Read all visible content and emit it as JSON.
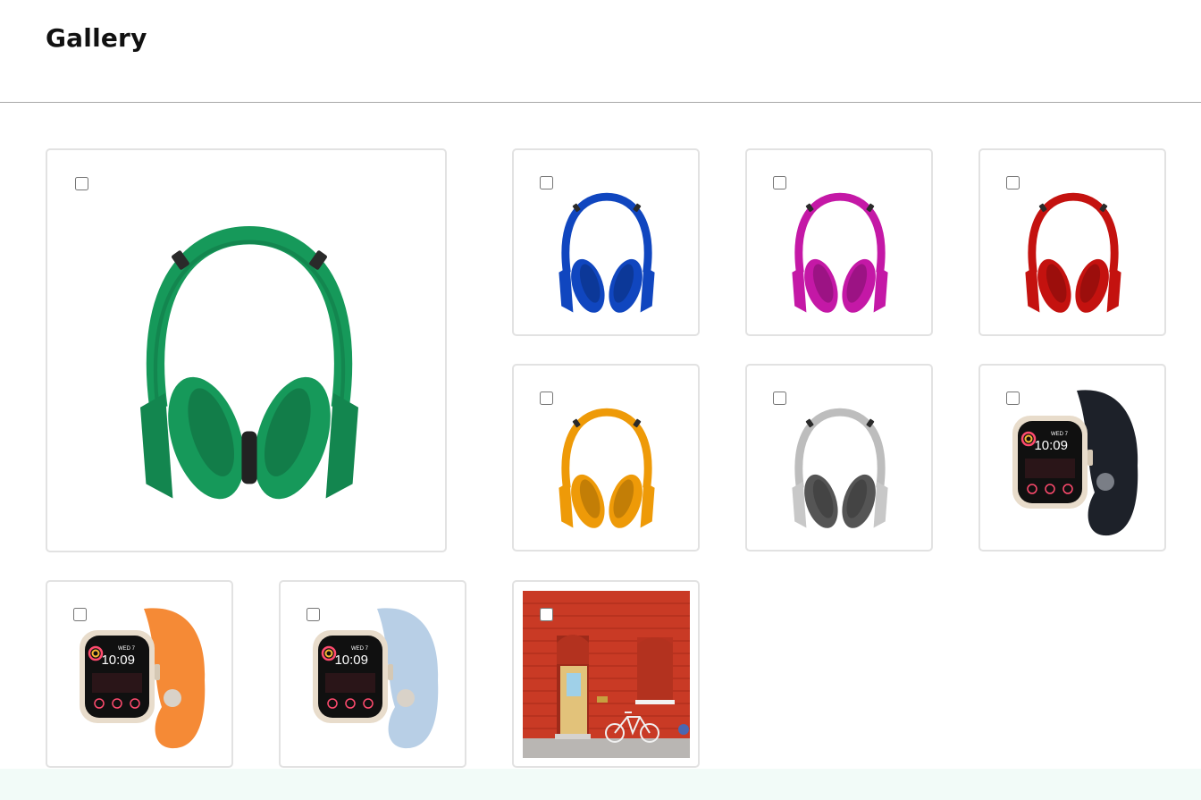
{
  "header": {
    "title": "Gallery"
  },
  "gallery": {
    "items": [
      {
        "image": "headphones",
        "color": "#16995a",
        "selected": false
      },
      {
        "image": "headphones",
        "color": "#1046bf",
        "selected": false
      },
      {
        "image": "headphones",
        "color": "#c418a6",
        "selected": false
      },
      {
        "image": "headphones",
        "color": "#c4120f",
        "selected": false
      },
      {
        "image": "headphones",
        "color": "#ee9a08",
        "selected": false
      },
      {
        "image": "headphones",
        "color": "#bdbdbd",
        "selected": false
      },
      {
        "image": "smartwatch",
        "band_color": "#1d2129",
        "watch_face": {
          "day": "WED 7",
          "time": "10:09"
        },
        "selected": false
      },
      {
        "image": "smartwatch",
        "band_color": "#f58a36",
        "watch_face": {
          "day": "WED 7",
          "time": "10:09"
        },
        "selected": false
      },
      {
        "image": "smartwatch",
        "band_color": "#b8cfe6",
        "watch_face": {
          "day": "WED 7",
          "time": "10:09"
        },
        "selected": false
      },
      {
        "image": "red-brick-wall-door-bicycle",
        "selected": false
      }
    ]
  },
  "theme": {
    "accent_band": "#f2fbf8",
    "tile_border": "#e2e2e2"
  }
}
